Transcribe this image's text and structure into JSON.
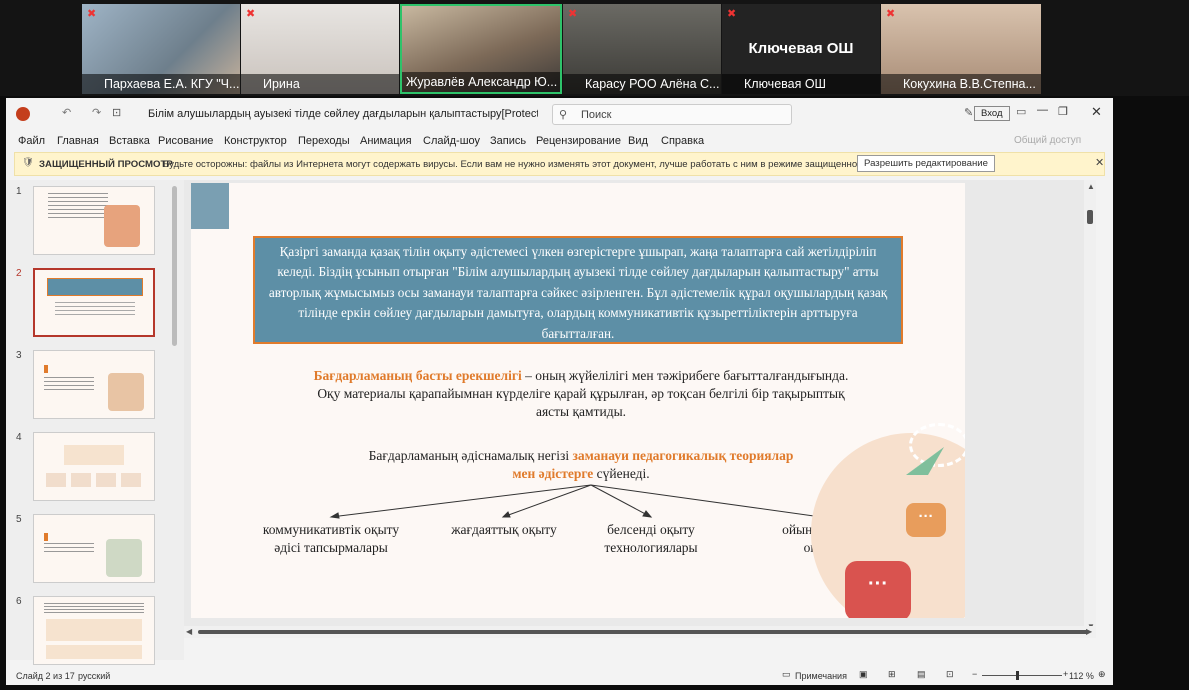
{
  "participants": [
    {
      "name": "Пархаева Е.А. КГУ \"Ч...",
      "bg": "#7a8c9a",
      "muted": true
    },
    {
      "name": "Ирина",
      "bg": "#cfcac6",
      "muted": true
    },
    {
      "name": "Журавлёв Александр Ю...",
      "bg": "#9a8a7a",
      "muted": false,
      "active": true
    },
    {
      "name": "Карасу РОО Алёна С...",
      "bg": "#5a5a55",
      "muted": true
    },
    {
      "name": "Ключевая ОШ",
      "bg": "#222222",
      "muted": true,
      "avatar_text": "Ключевая ОШ"
    },
    {
      "name": "Кокухина В.В.Степна...",
      "bg": "#b39a86",
      "muted": true
    }
  ],
  "app": {
    "title": "Білім алушылардың ауызекі тілде сөйлеу дағдыларын қалыптастыру[Protected View] - PowerP...",
    "search_placeholder": "Поиск",
    "signin": "Вход",
    "share": "Общий доступ",
    "menu": [
      "Файл",
      "Главная",
      "Вставка",
      "Рисование",
      "Конструктор",
      "Переходы",
      "Анимация",
      "Слайд-шоу",
      "Запись",
      "Рецензирование",
      "Вид",
      "Справка"
    ],
    "protected_title": "ЗАЩИЩЕННЫЙ ПРОСМОТР",
    "protected_text": "Будьте осторожны: файлы из Интернета могут содержать вирусы. Если вам не нужно изменять этот документ, лучше работать с ним в режиме защищенного просмотра.",
    "enable_editing": "Разрешить редактирование"
  },
  "thumbnails": [
    "1",
    "2",
    "3",
    "4",
    "5",
    "6"
  ],
  "slide": {
    "box_text": "Қазіргі заманда қазақ тілін оқыту әдістемесі үлкен өзгерістерге ұшырап, жаңа талаптарға сай жетілдіріліп келеді. Біздің ұсынып отырған \"Білім алушылардың ауызекі тілде сөйлеу дағдыларын қалыптастыру\" атты авторлық жұмысымыз осы заманауи талаптарға сәйкес әзірленген. Бұл әдістемелік құрал оқушылардың қазақ тілінде еркін сөйлеу дағдыларын дамытуға, олардың коммуникативтік құзыреттіліктерін арттыруға бағытталған.",
    "feature_bold": "Бағдарламаның басты ерекшелігі",
    "feature_rest": " – оның жүйелілігі мен тәжірибеге бағытталғандығында. Оқу материалы қарапайымнан күрделіге қарай құрылған, әр тоқсан белгілі бір тақырыптық аясты қамтиды.",
    "basis_pre": "Бағдарламаның әдіснамалық негізі ",
    "basis_bold": "заманауи педагогикалық теориялар мен әдістерге",
    "basis_post": " сүйенеді.",
    "methods": [
      "коммуникативтік оқыту әдісі тапсырмалары",
      "жағдаяттық оқыту",
      "белсенді оқыту технологиялары",
      "ойын арқылы оқыту"
    ]
  },
  "status": {
    "slide_info": "Слайд 2 из 17",
    "language": "русский",
    "notes": "Примечания",
    "zoom": "112 %"
  }
}
